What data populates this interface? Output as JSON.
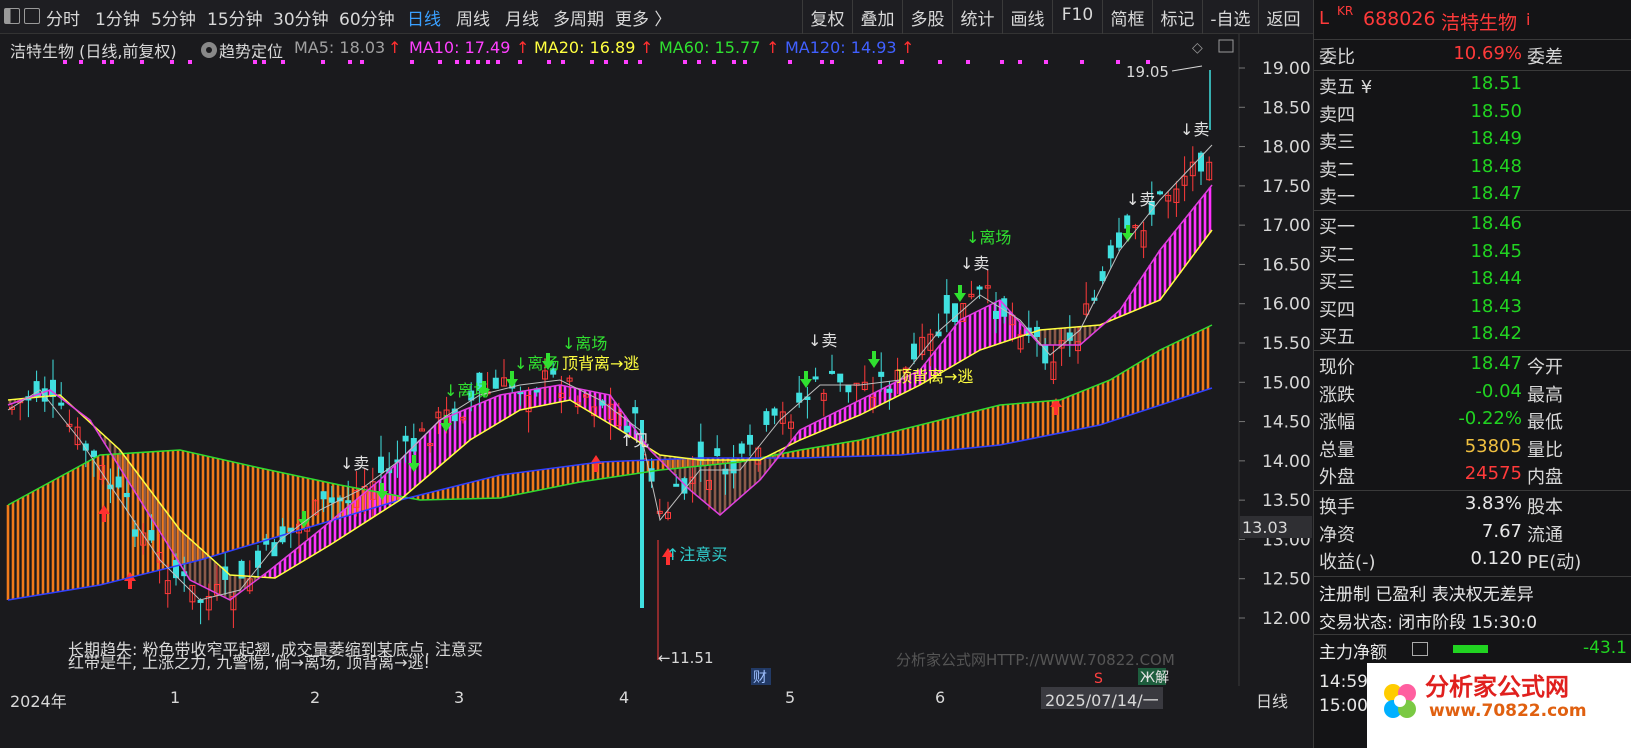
{
  "toolbar": {
    "periods": [
      "分时",
      "1分钟",
      "5分钟",
      "15分钟",
      "30分钟",
      "60分钟",
      "日线",
      "周线",
      "月线",
      "多周期",
      "更多 〉"
    ],
    "active_period": "日线",
    "tools": [
      "复权",
      "叠加",
      "多股",
      "统计",
      "画线",
      "F10",
      "简框",
      "标记",
      "-自选",
      "返回"
    ]
  },
  "infobar": {
    "title": "洁特生物 (日线,前复权)",
    "indicator": "趋势定位",
    "ma5": "MA5: 18.03",
    "ma10": "MA10: 17.49",
    "ma20": "MA20: 16.89",
    "ma60": "MA60: 15.77",
    "ma120": "MA120: 14.93",
    "arrow": "↑"
  },
  "panel": {
    "prefix": "L",
    "market": "KR",
    "code": "688026",
    "name": "洁特生物",
    "info_icon": "i",
    "weibi": {
      "label": "委比",
      "value": "10.69%",
      "label2": "委差"
    },
    "sell": [
      {
        "label": "卖五 ¥",
        "value": "18.51"
      },
      {
        "label": "卖四",
        "value": "18.50"
      },
      {
        "label": "卖三",
        "value": "18.49"
      },
      {
        "label": "卖二",
        "value": "18.48"
      },
      {
        "label": "卖一",
        "value": "18.47"
      }
    ],
    "buy": [
      {
        "label": "买一",
        "value": "18.46"
      },
      {
        "label": "买二",
        "value": "18.45"
      },
      {
        "label": "买三",
        "value": "18.44"
      },
      {
        "label": "买四",
        "value": "18.43"
      },
      {
        "label": "买五",
        "value": "18.42"
      }
    ],
    "quote": [
      {
        "label": "现价",
        "value": "18.47",
        "label2": "今开",
        "color": "green"
      },
      {
        "label": "涨跌",
        "value": "-0.04",
        "label2": "最高",
        "color": "green"
      },
      {
        "label": "涨幅",
        "value": "-0.22%",
        "label2": "最低",
        "color": "green"
      },
      {
        "label": "总量",
        "value": "53805",
        "label2": "量比",
        "color": "yellow"
      },
      {
        "label": "外盘",
        "value": "24575",
        "label2": "内盘",
        "color": "red"
      }
    ],
    "fund": [
      {
        "label": "换手",
        "value": "3.83%",
        "label2": "股本"
      },
      {
        "label": "净资",
        "value": "7.67",
        "label2": "流通"
      },
      {
        "label": "收益(-)",
        "value": "0.120",
        "label2": "PE(动)"
      }
    ],
    "tags": "注册制 已盈利 表决权无差异",
    "trade_status": "交易状态: 闭市阶段 15:30:0",
    "main_flow_label": "主力净额",
    "main_flow_value": "-43.1",
    "time1": "14:59",
    "time2": "15:00"
  },
  "xaxis": {
    "labels": [
      "2024年",
      "1",
      "2",
      "3",
      "4",
      "5",
      "6"
    ],
    "cursor_date": "2025/07/14/一",
    "right_label": "日线"
  },
  "chart": {
    "y_ticks": [
      "19.00",
      "18.50",
      "18.00",
      "17.50",
      "17.00",
      "16.50",
      "16.00",
      "15.50",
      "15.00",
      "14.50",
      "14.00",
      "13.50",
      "13.00",
      "12.50",
      "12.00"
    ],
    "price_tag": "13.03",
    "high_label": "19.05",
    "low_label": "←11.51",
    "signals": [
      "↓卖",
      "↓离场",
      "↓离场",
      "↓离场",
      "顶背离→逃",
      "↑见",
      "↑注意买",
      "↓卖",
      "顶背离→逃",
      "↓卖",
      "↓离场",
      "↓卖",
      "↓卖"
    ],
    "legend_line1": "长期趋失:  粉色带收窄平起翘,  成交量萎缩到某底点,  注意买",
    "legend_line2": "红带是牛,  上涨之力,  九警惕,  倘→离场,  顶背离→逃!",
    "watermark": "分析家公式网HTTP://WWW.70822.COM",
    "badge_cai": "财",
    "badge_s": "S",
    "badge_jie": "Ж解"
  },
  "logo": {
    "brand": "分析家公式网",
    "url": "www.70822.com"
  }
}
